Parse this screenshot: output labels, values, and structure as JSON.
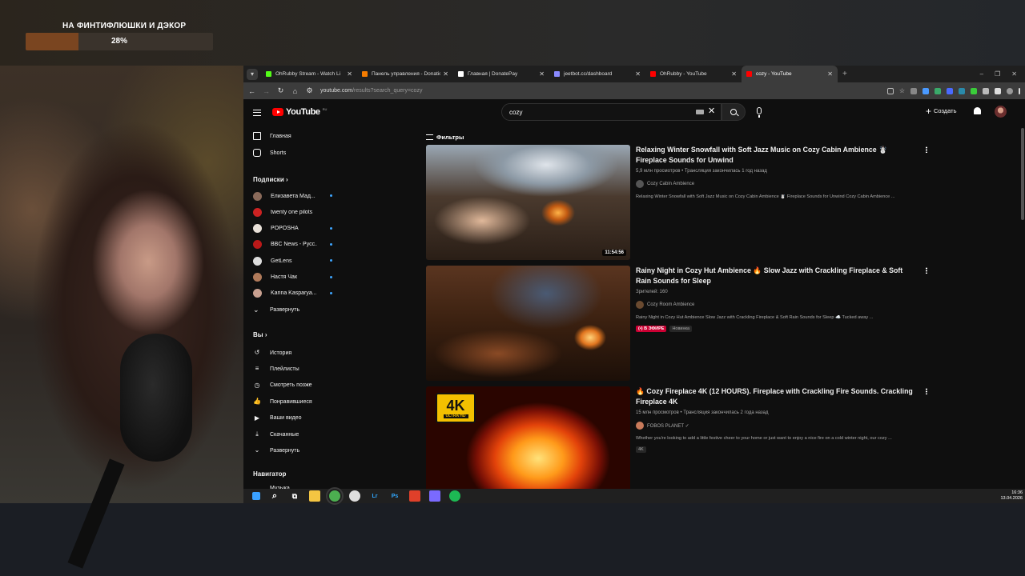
{
  "overlay": {
    "goal_title": "НА ФИНТИФЛЮШКИ И ДЭКОР",
    "goal_percent_label": "28%",
    "goal_progress": 0.28
  },
  "browser": {
    "tabs": [
      {
        "title": "OhRubby Stream - Watch Li",
        "fav_color": "#53fc18",
        "icon": "kick-icon"
      },
      {
        "title": "Панель управления - Donatio",
        "fav_color": "#f57c00",
        "icon": "donationalerts-icon"
      },
      {
        "title": "Главная | DonatePay",
        "fav_color": "#ffffff",
        "icon": "donatepay-icon"
      },
      {
        "title": "jeetbot.cc/dashboard",
        "fav_color": "#8a8aff",
        "icon": "page-icon"
      },
      {
        "title": "OhRubby - YouTube",
        "fav_color": "#ff0000",
        "icon": "youtube-icon"
      },
      {
        "title": "cozy - YouTube",
        "fav_color": "#ff0000",
        "icon": "youtube-icon"
      }
    ],
    "url_host": "youtube.com",
    "url_path": "/results?search_query=cozy"
  },
  "youtube": {
    "logo_text": "YouTube",
    "logo_region": "RU",
    "search_value": "cozy",
    "create_label": "Создать",
    "sidebar": {
      "home": "Главная",
      "shorts": "Shorts",
      "subscriptions_header": "Подписки",
      "subscriptions": [
        {
          "name": "Елизавета Мад...",
          "color": "#8a6a5a",
          "live": true
        },
        {
          "name": "twenty one pilots",
          "color": "#cc2222",
          "live": false
        },
        {
          "name": "POPOSHA",
          "color": "#e8e0d8",
          "live": true
        },
        {
          "name": "BBC News - Русс...",
          "color": "#bb1919",
          "live": true
        },
        {
          "name": "GetLens",
          "color": "#dddddd",
          "live": true
        },
        {
          "name": "Настя Чак",
          "color": "#b07a5a",
          "live": true
        },
        {
          "name": "Karina Kasparya...",
          "color": "#c8a090",
          "live": true
        }
      ],
      "expand_subs": "Развернуть",
      "you_header": "Вы",
      "you_items": [
        "История",
        "Плейлисты",
        "Смотреть позже",
        "Понравившиеся",
        "Ваши видео",
        "Скачанные",
        "Развернуть"
      ],
      "navigator_header": "Навигатор",
      "navigator_first": "Музыка"
    },
    "filters_label": "Фильтры",
    "results": [
      {
        "title": "Relaxing Winter Snowfall with Soft Jazz Music on Cozy Cabin Ambience ☃️ Fireplace Sounds for Unwind",
        "meta": "5,9 млн просмотров • Трансляция закончилась 1 год назад",
        "channel": "Cozy Cabin Ambience",
        "channel_color": "#555555",
        "description": "Relaxing Winter Snowfall with Soft Jazz Music on Cozy Cabin Ambience ☃️ Fireplace Sounds for Unwind Cozy Cabin Ambience ...",
        "duration": "11:54:56",
        "tags": []
      },
      {
        "title": "Rainy Night in Cozy Hut Ambience 🔥 Slow Jazz with Crackling Fireplace & Soft Rain Sounds for Sleep",
        "meta": "Зрителей: 160",
        "channel": "Cozy Room Ambience",
        "channel_color": "#6a4a30",
        "description": "Rainy Night in Cozy Hut Ambience Slow Jazz with Crackling Fireplace & Soft Rain Sounds for Sleep ☁️ Tucked away ...",
        "duration": "",
        "tags": [
          "(•) В ЭФИРЕ",
          "Новинка"
        ]
      },
      {
        "title": "🔥 Cozy Fireplace 4K (12 HOURS). Fireplace with Crackling Fire Sounds. Crackling Fireplace 4K",
        "meta": "15 млн просмотров • Трансляция закончилась 2 года назад",
        "channel": "FOBOS PLANET ✓",
        "channel_color": "#c87a5a",
        "description": "Whether you're looking to add a little festive cheer to your home or just want to enjoy a nice fire on a cold winter night, our cozy ...",
        "duration": "",
        "tags": [
          "4K"
        ],
        "badge_big": "4K",
        "badge_small": "ULTRA HD"
      }
    ]
  },
  "taskbar": {
    "items": [
      {
        "icon": "windows-start-icon",
        "label": "",
        "color": "#3aa0ff"
      },
      {
        "icon": "search-icon",
        "label": "",
        "color": "#ffffff"
      },
      {
        "icon": "task-view-icon",
        "label": "",
        "color": "#ffffff"
      },
      {
        "icon": "file-explorer-icon",
        "label": "",
        "color": "#f4c542"
      },
      {
        "icon": "chrome-icon",
        "label": "",
        "color": "#4caf50"
      },
      {
        "icon": "obs-icon",
        "label": "",
        "color": "#dddddd"
      },
      {
        "icon": "lightroom-icon",
        "label": "Lr",
        "color": "#31a8ff"
      },
      {
        "icon": "photoshop-icon",
        "label": "Ps",
        "color": "#31a8ff"
      },
      {
        "icon": "app-icon",
        "label": "",
        "color": "#e0402a"
      },
      {
        "icon": "app-icon",
        "label": "",
        "color": "#7a6aff"
      },
      {
        "icon": "spotify-icon",
        "label": "",
        "color": "#1db954"
      }
    ],
    "time": "16:36",
    "date": "13.04.2026"
  }
}
